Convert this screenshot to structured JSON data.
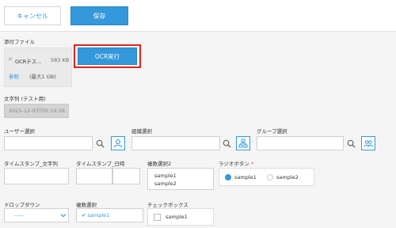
{
  "toolbar": {
    "cancel_label": "キャンセル",
    "save_label": "保存"
  },
  "attachment": {
    "label": "添付ファイル",
    "file_name": "OCRテス…",
    "file_size": "583 KB",
    "browse_label": "参照",
    "max_size": "(最大1 GB)",
    "ocr_button_label": "OCR実行"
  },
  "text_field": {
    "label": "文字列 (テスト用)",
    "value": "2025-12-03T05:19:38."
  },
  "user_select": {
    "label": "ユーザー選択"
  },
  "org_select": {
    "label": "組織選択"
  },
  "group_select": {
    "label": "グループ選択"
  },
  "timestamp_text": {
    "label": "タイムスタンプ_文字列"
  },
  "timestamp_datetime": {
    "label": "タイムスタンプ_日時"
  },
  "multi_select_list": {
    "label": "複数選択2",
    "options": [
      "sample1",
      "sample2"
    ]
  },
  "radio": {
    "label": "ラジオボタン",
    "required_mark": "*",
    "options": [
      "sample1",
      "sample2"
    ],
    "selected": "sample1"
  },
  "dropdown": {
    "label": "ドロップダウン",
    "value": "-----"
  },
  "multi_select": {
    "label": "複数選択",
    "selected": [
      "sample1"
    ]
  },
  "checkbox": {
    "label": "チェックボックス",
    "options": [
      "sample1"
    ]
  },
  "colors": {
    "accent": "#3498db",
    "highlight": "#e0241b",
    "required": "#e74c3c"
  }
}
